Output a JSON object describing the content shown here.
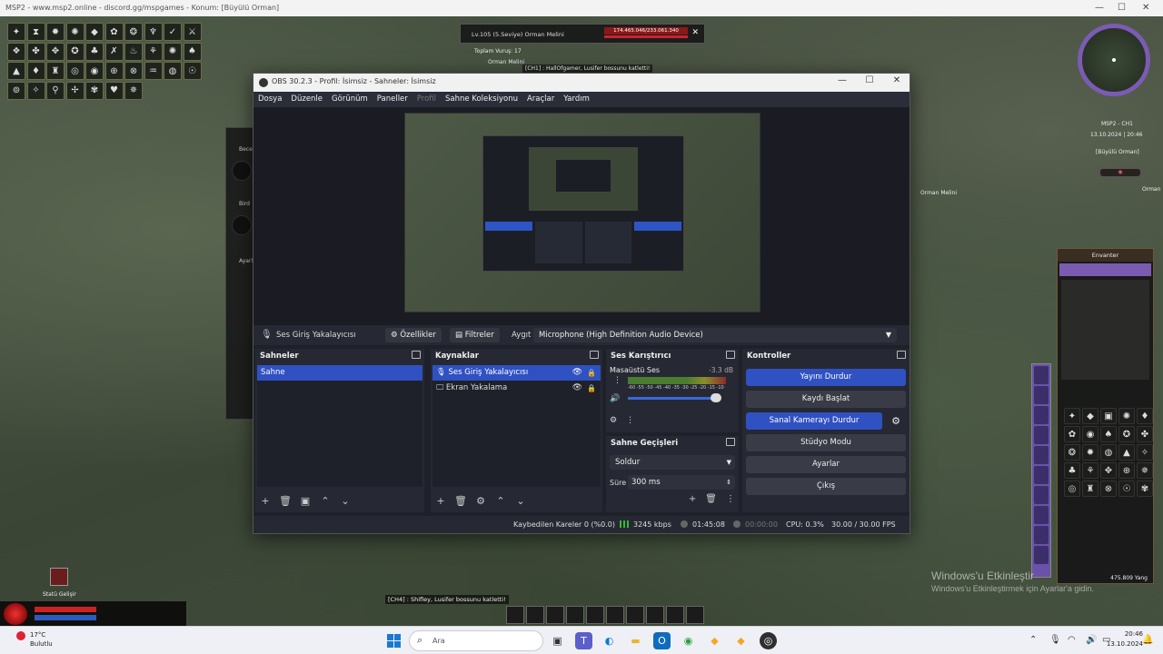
{
  "browser": {
    "title": "MSP2 - www.msp2.online - discord.gg/mspgames - Konum: [Büyülü Orman]"
  },
  "game": {
    "target_level": "Lv.105 (5.Seviye) Orman Melini",
    "target_hp": "174.465.046/233.061.340",
    "line_total": "Toplam Vuruş: 17",
    "line_orman": "Orman Melini",
    "line_msg": "[CH1] : HallOfgamer, Lusifer bossunu katletti!",
    "minimap_name": "MSP2 - CH1",
    "minimap_date": "13.10.2024 | 20:46",
    "minimap_loc": "[Büyülü Orman]",
    "orman_right": "Orman",
    "orman_mid": "Orman Melini",
    "left_panel_1": "Beceri",
    "left_panel_2": "Bird",
    "left_panel_3": "Ayarl",
    "inventory_title": "Envanter",
    "inventory_gold": "475.809 Yang",
    "bottom_left_label": "Statü Gelişir",
    "chat_msg": "[CH4] : Shifley, Lusifer bossunu katletti!",
    "watermark_line1": "Windows'u Etkinleştir",
    "watermark_line2": "Windows'u Etkinleştirmek için Ayarlar'a gidin."
  },
  "obs": {
    "title": "OBS 30.2.3 - Profil: İsimsiz - Sahneler: İsimsiz",
    "menu": [
      "Dosya",
      "Düzenle",
      "Görünüm",
      "Paneller",
      "Profil",
      "Sahne Koleksiyonu",
      "Araçlar",
      "Yardım"
    ],
    "source_bar": {
      "source_name": "Ses Giriş Yakalayıcısı",
      "properties_label": "Özellikler",
      "filters_label": "Filtreler",
      "device_label": "Aygıt",
      "device_value": "Microphone (High Definition Audio Device)"
    },
    "scenes": {
      "title": "Sahneler",
      "items": [
        "Sahne"
      ]
    },
    "sources": {
      "title": "Kaynaklar",
      "items": [
        "Ses Giriş Yakalayıcısı",
        "Ekran Yakalama"
      ]
    },
    "mixer": {
      "title": "Ses Karıştırıcı",
      "channel": "Masaüstü Ses",
      "db": "-3.3 dB",
      "scale": "-60 -55 -50 -45 -40 -35 -30 -25 -20 -15 -10 -5 0",
      "level_fraction": 0.9
    },
    "transitions": {
      "title": "Sahne Geçişleri",
      "selected": "Soldur",
      "duration_label": "Süre",
      "duration_value": "300 ms"
    },
    "controls": {
      "title": "Kontroller",
      "stop_stream": "Yayını Durdur",
      "start_record": "Kaydı Başlat",
      "stop_vcam": "Sanal Kamerayı Durdur",
      "studio_mode": "Stüdyo Modu",
      "settings": "Ayarlar",
      "exit": "Çıkış"
    },
    "status": {
      "dropped": "Kaybedilen Kareler 0 (%0.0)",
      "bitrate": "3245 kbps",
      "stream_time": "01:45:08",
      "rec_time": "00:00:00",
      "cpu": "CPU: 0.3%",
      "fps": "30.00 / 30.00 FPS"
    }
  },
  "taskbar": {
    "weather_temp": "17°C",
    "weather_desc": "Bulutlu",
    "search_placeholder": "Ara",
    "time": "20:46",
    "date": "13.10.2024"
  },
  "colors": {
    "obs_bg": "#1f212a",
    "obs_accent": "#3051c2",
    "taskbar_bg": "#eef0f5"
  }
}
